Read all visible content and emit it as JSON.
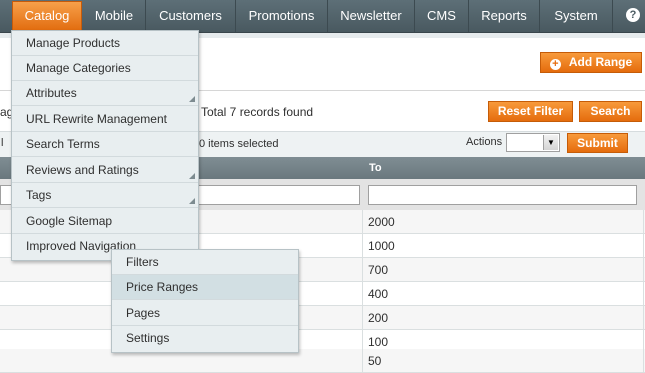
{
  "nav": {
    "items": [
      {
        "label": "Catalog",
        "active": true
      },
      {
        "label": "Mobile"
      },
      {
        "label": "Customers"
      },
      {
        "label": "Promotions"
      },
      {
        "label": "Newsletter"
      },
      {
        "label": "CMS"
      },
      {
        "label": "Reports"
      },
      {
        "label": "System"
      }
    ],
    "help_icon": "question-mark"
  },
  "toolbar": {
    "add_button": "Add Range",
    "reset_button": "Reset Filter",
    "search_button": "Search",
    "records_fragment": "ag",
    "records": "Total 7 records found",
    "left_fragment": "l",
    "selected": "0 items selected",
    "actions_label": "Actions",
    "submit_button": "Submit"
  },
  "grid": {
    "to_header": "To",
    "rows": [
      "2000",
      "1000",
      "700",
      "400",
      "200",
      "100",
      "50"
    ]
  },
  "catalog_menu": [
    {
      "label": "Manage Products"
    },
    {
      "label": "Manage Categories"
    },
    {
      "label": "Attributes",
      "has_submenu": true
    },
    {
      "label": "URL Rewrite Management"
    },
    {
      "label": "Search Terms"
    },
    {
      "label": "Reviews and Ratings",
      "has_submenu": true
    },
    {
      "label": "Tags",
      "has_submenu": true
    },
    {
      "label": "Google Sitemap"
    },
    {
      "label": "Improved Navigation"
    }
  ],
  "navigation_submenu": [
    {
      "label": "Filters"
    },
    {
      "label": "Price Ranges",
      "highlighted": true
    },
    {
      "label": "Pages"
    },
    {
      "label": "Settings"
    }
  ],
  "colors": {
    "accent": "#e56c0d",
    "nav_bg": "#52636a",
    "menu_bg": "#e8eef0"
  }
}
